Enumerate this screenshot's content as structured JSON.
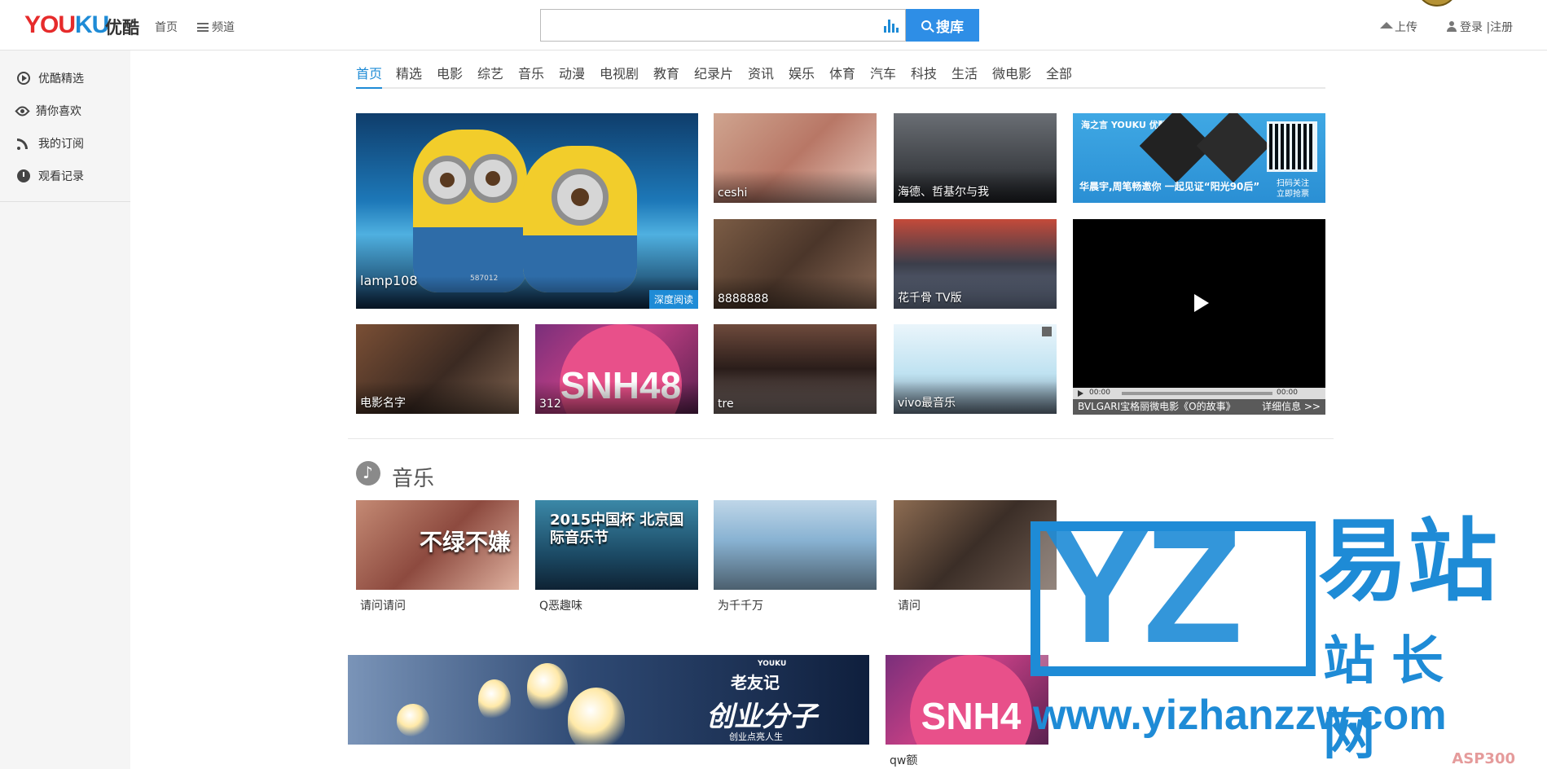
{
  "header": {
    "logo_en_1": "YOU",
    "logo_en_2": "KU",
    "logo_cn": "优酷",
    "nav_home": "首页",
    "nav_channel": "频道",
    "search_value": "",
    "search_button": "搜库",
    "upload": "上传",
    "login": "登录",
    "separator": "|",
    "register": "注册"
  },
  "sidebar": {
    "items": [
      {
        "label": "优酷精选",
        "icon": "play-circle-icon"
      },
      {
        "label": "猜你喜欢",
        "icon": "eye-icon"
      },
      {
        "label": "我的订阅",
        "icon": "rss-icon"
      },
      {
        "label": "观看记录",
        "icon": "clock-icon"
      }
    ]
  },
  "categories": [
    "首页",
    "精选",
    "电影",
    "综艺",
    "音乐",
    "动漫",
    "电视剧",
    "教育",
    "纪录片",
    "资讯",
    "娱乐",
    "体育",
    "汽车",
    "科技",
    "生活",
    "微电影",
    "全部"
  ],
  "featured": {
    "main_caption": "lamp108",
    "main_badge": "深度阅读",
    "main_watermark": "587012",
    "tiles": [
      "ceshi",
      "海德、哲基尔与我",
      "8888888",
      "花千骨 TV版",
      "电影名字",
      "312",
      "tre",
      "vivo最音乐"
    ],
    "ad_logo": "海之言 YOUKU 优酷",
    "ad_text": "华晨宇,周笔畅邀你 一起见证“阳光90后”",
    "ad_qr_text_1": "扫码关注",
    "ad_qr_text_2": "立即抢票",
    "snh_label": "SNH48",
    "video": {
      "time_current": "00:00",
      "time_total": "00:00",
      "title": "BVLGARI宝格丽微电影《O的故事》",
      "more": "详细信息 >>"
    }
  },
  "music": {
    "title": "音乐",
    "items": [
      {
        "caption": "请问请问",
        "overlay": "不绿不嫌"
      },
      {
        "caption": "Q恶趣味",
        "overlay": "2015中国杯 北京国际音乐节"
      },
      {
        "caption": "为千千万",
        "overlay": ""
      },
      {
        "caption": "请问",
        "overlay": ""
      }
    ],
    "banner_logo": "YOUKU",
    "banner_title": "老友记",
    "banner_main": "创业分子",
    "banner_sub": "创业点亮人生",
    "snh2_caption": "qw额",
    "snh2_label": "SNH4"
  },
  "watermark": {
    "logo": "YZ",
    "cn_top": "易站",
    "cn_bottom": "站长网",
    "url": "www.yizhanzzw.com",
    "corner": "ASP300"
  },
  "colors": {
    "accent": "#1e8bd6",
    "search_button": "#2e8ee6",
    "logo_red": "#e62b2b"
  }
}
